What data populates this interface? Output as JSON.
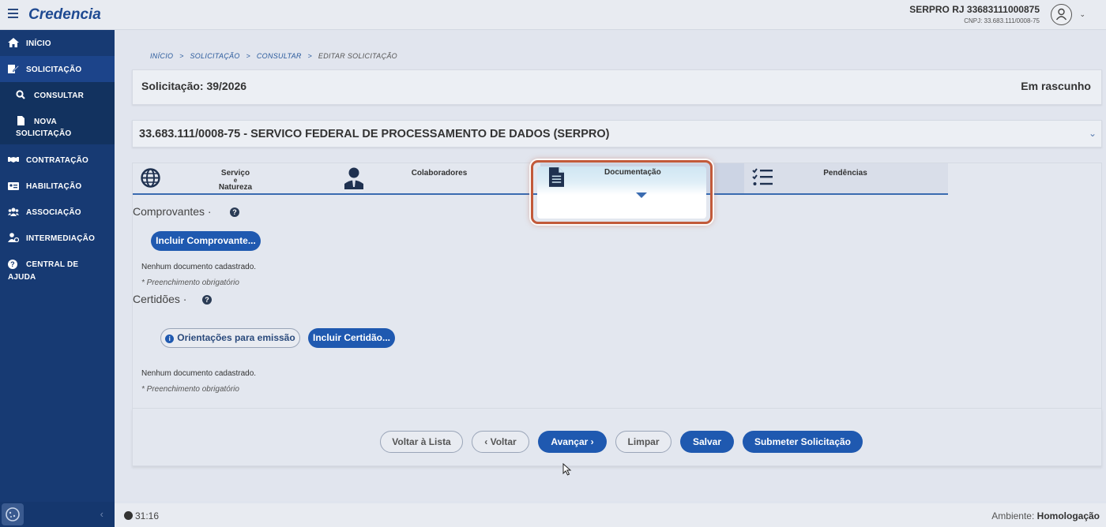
{
  "app": {
    "title": "Credencia"
  },
  "user": {
    "name": "SERPRO RJ 33683111000875",
    "cnpj": "CNPJ: 33.683.111/0008-75"
  },
  "sidebar": {
    "items": [
      {
        "label": "INÍCIO",
        "icon": "home-icon"
      },
      {
        "label": "SOLICITAÇÃO",
        "icon": "edit-icon"
      },
      {
        "label": "CONSULTAR",
        "icon": "search-icon"
      },
      {
        "label_line1": "NOVA",
        "label_line2": "SOLICITAÇÃO",
        "icon": "file-icon"
      },
      {
        "label": "CONTRATAÇÃO",
        "icon": "handshake-icon"
      },
      {
        "label": "HABILITAÇÃO",
        "icon": "id-card-icon"
      },
      {
        "label": "ASSOCIAÇÃO",
        "icon": "users-icon"
      },
      {
        "label": "INTERMEDIAÇÃO",
        "icon": "user-tie-icon"
      },
      {
        "label_line1": "CENTRAL DE",
        "label_line2": "AJUDA",
        "icon": "question-icon"
      }
    ]
  },
  "breadcrumb": {
    "items": [
      "INÍCIO",
      "SOLICITAÇÃO",
      "CONSULTAR"
    ],
    "current": "EDITAR SOLICITAÇÃO",
    "sep": ">"
  },
  "header": {
    "title": "Solicitação: 39/2026",
    "status": "Em rascunho"
  },
  "organization": {
    "name": "33.683.111/0008-75 - SERVICO FEDERAL DE PROCESSAMENTO DE DADOS (SERPRO)"
  },
  "tabs": [
    {
      "label_line1": "Serviço",
      "label_line2": "e",
      "label_line3": "Natureza",
      "icon": "globe-icon"
    },
    {
      "label": "Colaboradores",
      "icon": "person-icon"
    },
    {
      "label": "Documentação",
      "icon": "document-icon",
      "active": true
    },
    {
      "label": "Pendências",
      "icon": "checklist-icon"
    }
  ],
  "comprovantes": {
    "title": "Comprovantes ·",
    "include_button": "Incluir Comprovante...",
    "empty_text": "Nenhum documento cadastrado.",
    "required_text": "* Preenchimento obrigatório"
  },
  "certidoes": {
    "title": "Certidões ·",
    "orientation_button": "Orientações para emissão",
    "include_button": "Incluir Certidão...",
    "empty_text": "Nenhum documento cadastrado.",
    "required_text": "* Preenchimento obrigatório"
  },
  "actions": {
    "back_to_list": "Voltar à Lista",
    "back": "‹ Voltar",
    "next": "Avançar ›",
    "clear": "Limpar",
    "save": "Salvar",
    "submit": "Submeter Solicitação"
  },
  "footer": {
    "timer": "31:16",
    "environment_label": "Ambiente:",
    "environment_value": "Homologação"
  },
  "colors": {
    "sidebar": "#173a73",
    "primary": "#1f59b0",
    "highlight_border": "#c25a3a"
  }
}
